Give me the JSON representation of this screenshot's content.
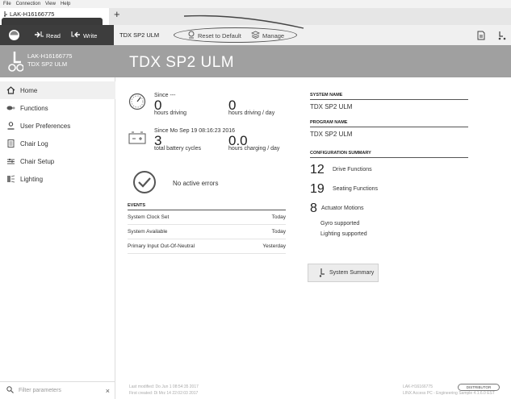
{
  "menubar": {
    "items": [
      "File",
      "Connection",
      "View",
      "Help"
    ]
  },
  "tabs": {
    "device_tab": "LAK-H16166775",
    "add_tab": "+"
  },
  "toolbar": {
    "read_label": "Read",
    "write_label": "Write",
    "page_title": "TDX SP2 ULM",
    "reset_label": "Reset to Default",
    "manage_label": "Manage"
  },
  "device": {
    "serial": "LAK-H16166775",
    "model": "TDX SP2 ULM"
  },
  "sidebar": {
    "items": [
      {
        "label": "Home",
        "icon": "home-icon"
      },
      {
        "label": "Functions",
        "icon": "functions-icon"
      },
      {
        "label": "User Preferences",
        "icon": "user-icon"
      },
      {
        "label": "Chair Log",
        "icon": "log-icon"
      },
      {
        "label": "Chair Setup",
        "icon": "setup-icon"
      },
      {
        "label": "Lighting",
        "icon": "lighting-icon"
      }
    ],
    "filter_placeholder": "Filter parameters",
    "filter_clear": "×"
  },
  "banner": {
    "title": "TDX SP2 ULM"
  },
  "driving": {
    "since_label": "Since ---",
    "hours_value": "0",
    "hours_label": "hours driving",
    "per_day_value": "0",
    "per_day_label": "hours driving / day"
  },
  "battery": {
    "since_label": "Since Mo Sep 19 08:16:23 2016",
    "cycles_value": "3",
    "cycles_label": "total battery cycles",
    "charging_value": "0.0",
    "charging_label": "hours charging / day"
  },
  "status": {
    "message": "No active errors"
  },
  "events": {
    "title": "EVENTS",
    "rows": [
      {
        "name": "System Clock Set",
        "when": "Today"
      },
      {
        "name": "System Available",
        "when": "Today"
      },
      {
        "name": "Primary Input Out-Of-Neutral",
        "when": "Yesterday"
      }
    ]
  },
  "system": {
    "system_name_label": "SYSTEM NAME",
    "system_name": "TDX SP2 ULM",
    "program_name_label": "PROGRAM NAME",
    "program_name": "TDX SP2 ULM",
    "config_label": "CONFIGURATION SUMMARY",
    "drive_count": "12",
    "drive_label": "Drive Functions",
    "seating_count": "19",
    "seating_label": "Seating Functions",
    "actuator_count": "8",
    "actuator_label": "Actuator Motions",
    "gyro": "Gyro supported",
    "lighting": "Lighting supported",
    "summary_button": "System Summary"
  },
  "footer": {
    "modified": "Last modified: Do Jun 1 08:54:35 2017",
    "created": "First created: Di Mrz 14 22:02:03 2017",
    "serial": "LAK-H16166775",
    "role": "DISTRIBUTOR",
    "app": "LINX Access PC - Engineering Sample 4.1.6.0 EST"
  }
}
